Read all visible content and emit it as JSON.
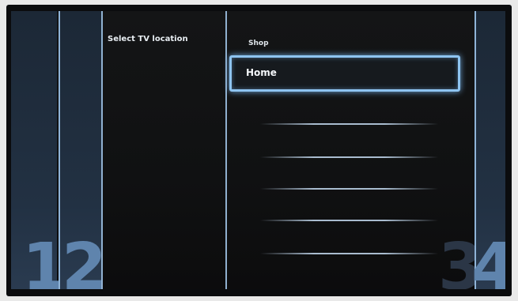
{
  "setup": {
    "panel_title": "Select TV location",
    "steps_left": [
      "1",
      "2"
    ],
    "steps_right": [
      "3",
      "4"
    ],
    "options": [
      {
        "label": "Shop",
        "selected": false
      },
      {
        "label": "Home",
        "selected": true
      }
    ],
    "empty_rows": 5
  },
  "colors": {
    "accent": "#8ec4f0",
    "step_number": "#5f84ad",
    "background": "#101112"
  }
}
